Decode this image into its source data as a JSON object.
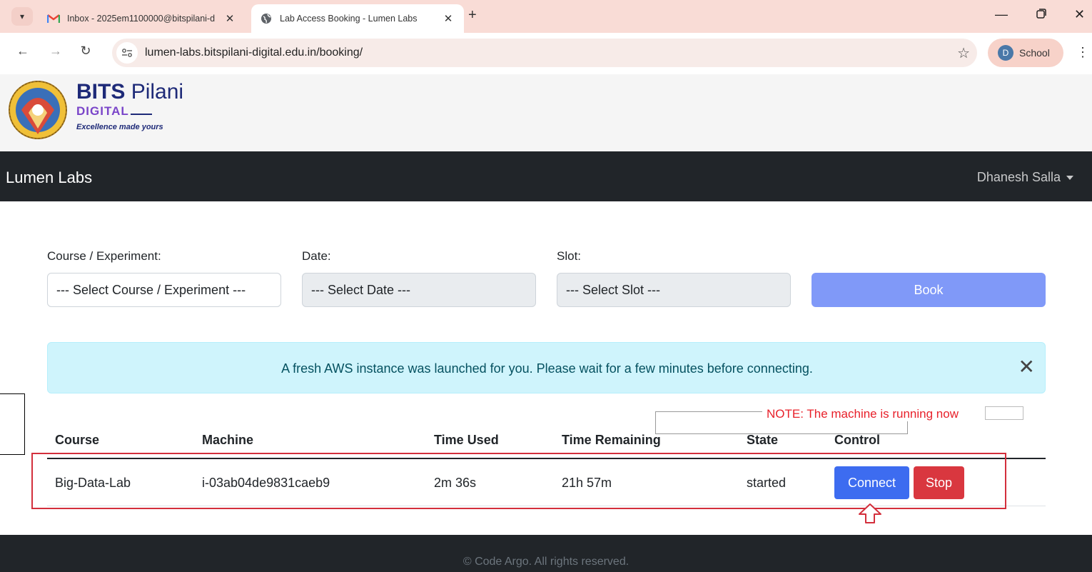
{
  "browser": {
    "tabs": [
      {
        "title": "Inbox - 2025em1100000@bitspilani-d",
        "icon": "gmail-icon",
        "active": false
      },
      {
        "title": "Lab Access Booking - Lumen Labs",
        "icon": "globe-icon",
        "active": true
      }
    ],
    "url": "lumen-labs.bitspilani-digital.edu.in/booking/",
    "profile": {
      "initial": "D",
      "name": "School"
    }
  },
  "logo": {
    "bits": "BITS",
    "pilani": "Pilani",
    "digital": "DIGITAL",
    "tagline": "Excellence made yours"
  },
  "navbar": {
    "brand": "Lumen Labs",
    "user": "Dhanesh Salla"
  },
  "form": {
    "course_label": "Course / Experiment:",
    "course_value": "--- Select Course / Experiment ---",
    "date_label": "Date:",
    "date_value": "--- Select Date ---",
    "slot_label": "Slot:",
    "slot_value": "--- Select Slot ---",
    "book_label": "Book"
  },
  "alert": {
    "message": "A fresh AWS instance was launched for you. Please wait for a few minutes before connecting.",
    "close": "✕"
  },
  "annotation": {
    "note": "NOTE: The machine is running now"
  },
  "table": {
    "headers": [
      "Course",
      "Machine",
      "Time Used",
      "Time Remaining",
      "State",
      "Control"
    ],
    "rows": [
      {
        "course": "Big-Data-Lab",
        "machine": "i-03ab04de9831caeb9",
        "time_used": "2m 36s",
        "time_remaining": "21h 57m",
        "state": "started",
        "connect_label": "Connect",
        "stop_label": "Stop"
      }
    ]
  },
  "footer": {
    "text": "© Code Argo. All rights reserved."
  },
  "colors": {
    "navbar_bg": "#212529",
    "book_btn": "#8099f8",
    "connect_btn": "#3d6cf0",
    "stop_btn": "#d9373f",
    "alert_bg": "#cff4fc",
    "annotation_red": "#e8202a"
  }
}
